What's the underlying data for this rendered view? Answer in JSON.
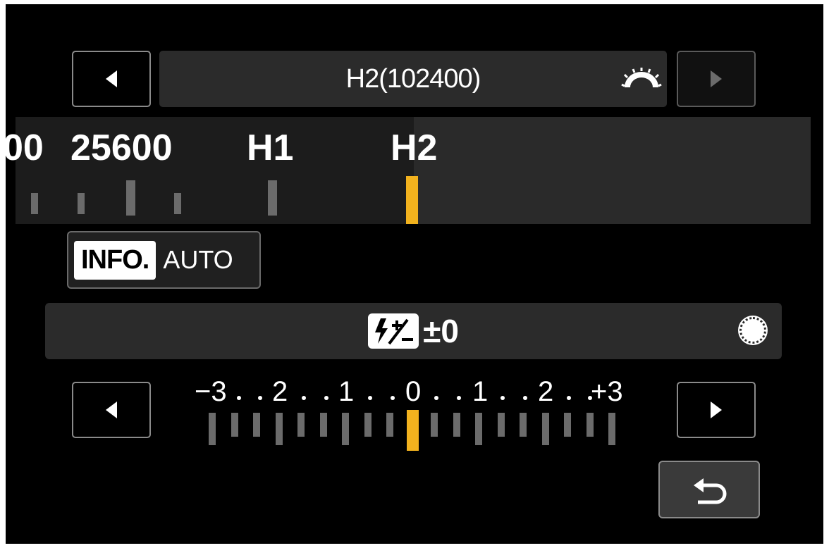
{
  "iso": {
    "current_value": "H2(102400)",
    "dial_icon": "main-dial-icon",
    "scale_labels": [
      "00",
      "25600",
      "H1",
      "H2"
    ],
    "selected_label": "H2"
  },
  "info_button": {
    "key_label": "INFO.",
    "action_label": "AUTO"
  },
  "flash_comp": {
    "icon": "flash-exposure-compensation-icon",
    "icon_text": "⚡±",
    "value": "±0",
    "quick_dial_icon": "quick-control-dial-icon",
    "scale_labels": [
      "−3",
      "2",
      "1",
      "0",
      "1",
      "2",
      "+3"
    ],
    "selected_value": 0
  },
  "navigation": {
    "prev_icon": "left-arrow-icon",
    "next_icon": "right-arrow-icon",
    "back_icon": "return-icon"
  },
  "colors": {
    "accent": "#f2b21e",
    "tick": "#6b6b6b",
    "panel": "#2b2b2b",
    "background": "#000000"
  }
}
